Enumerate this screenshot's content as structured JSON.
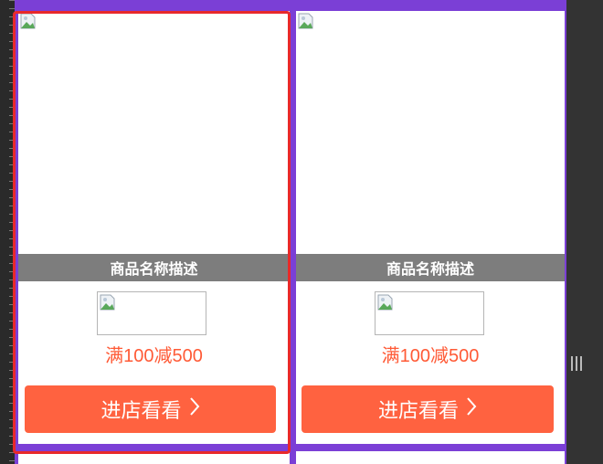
{
  "cards": [
    {
      "name": "商品名称描述",
      "promo": "满100减500",
      "cta": "进店看看",
      "cta_icon": "chevron-right-icon"
    },
    {
      "name": "商品名称描述",
      "promo": "满100减500",
      "cta": "进店看看",
      "cta_icon": "chevron-right-icon"
    }
  ],
  "colors": {
    "accent": "#ff6240",
    "promo": "#ff5a36",
    "selection": "#e8292b",
    "background": "#7b3fd6",
    "name_bar": "#7d7d7d"
  }
}
